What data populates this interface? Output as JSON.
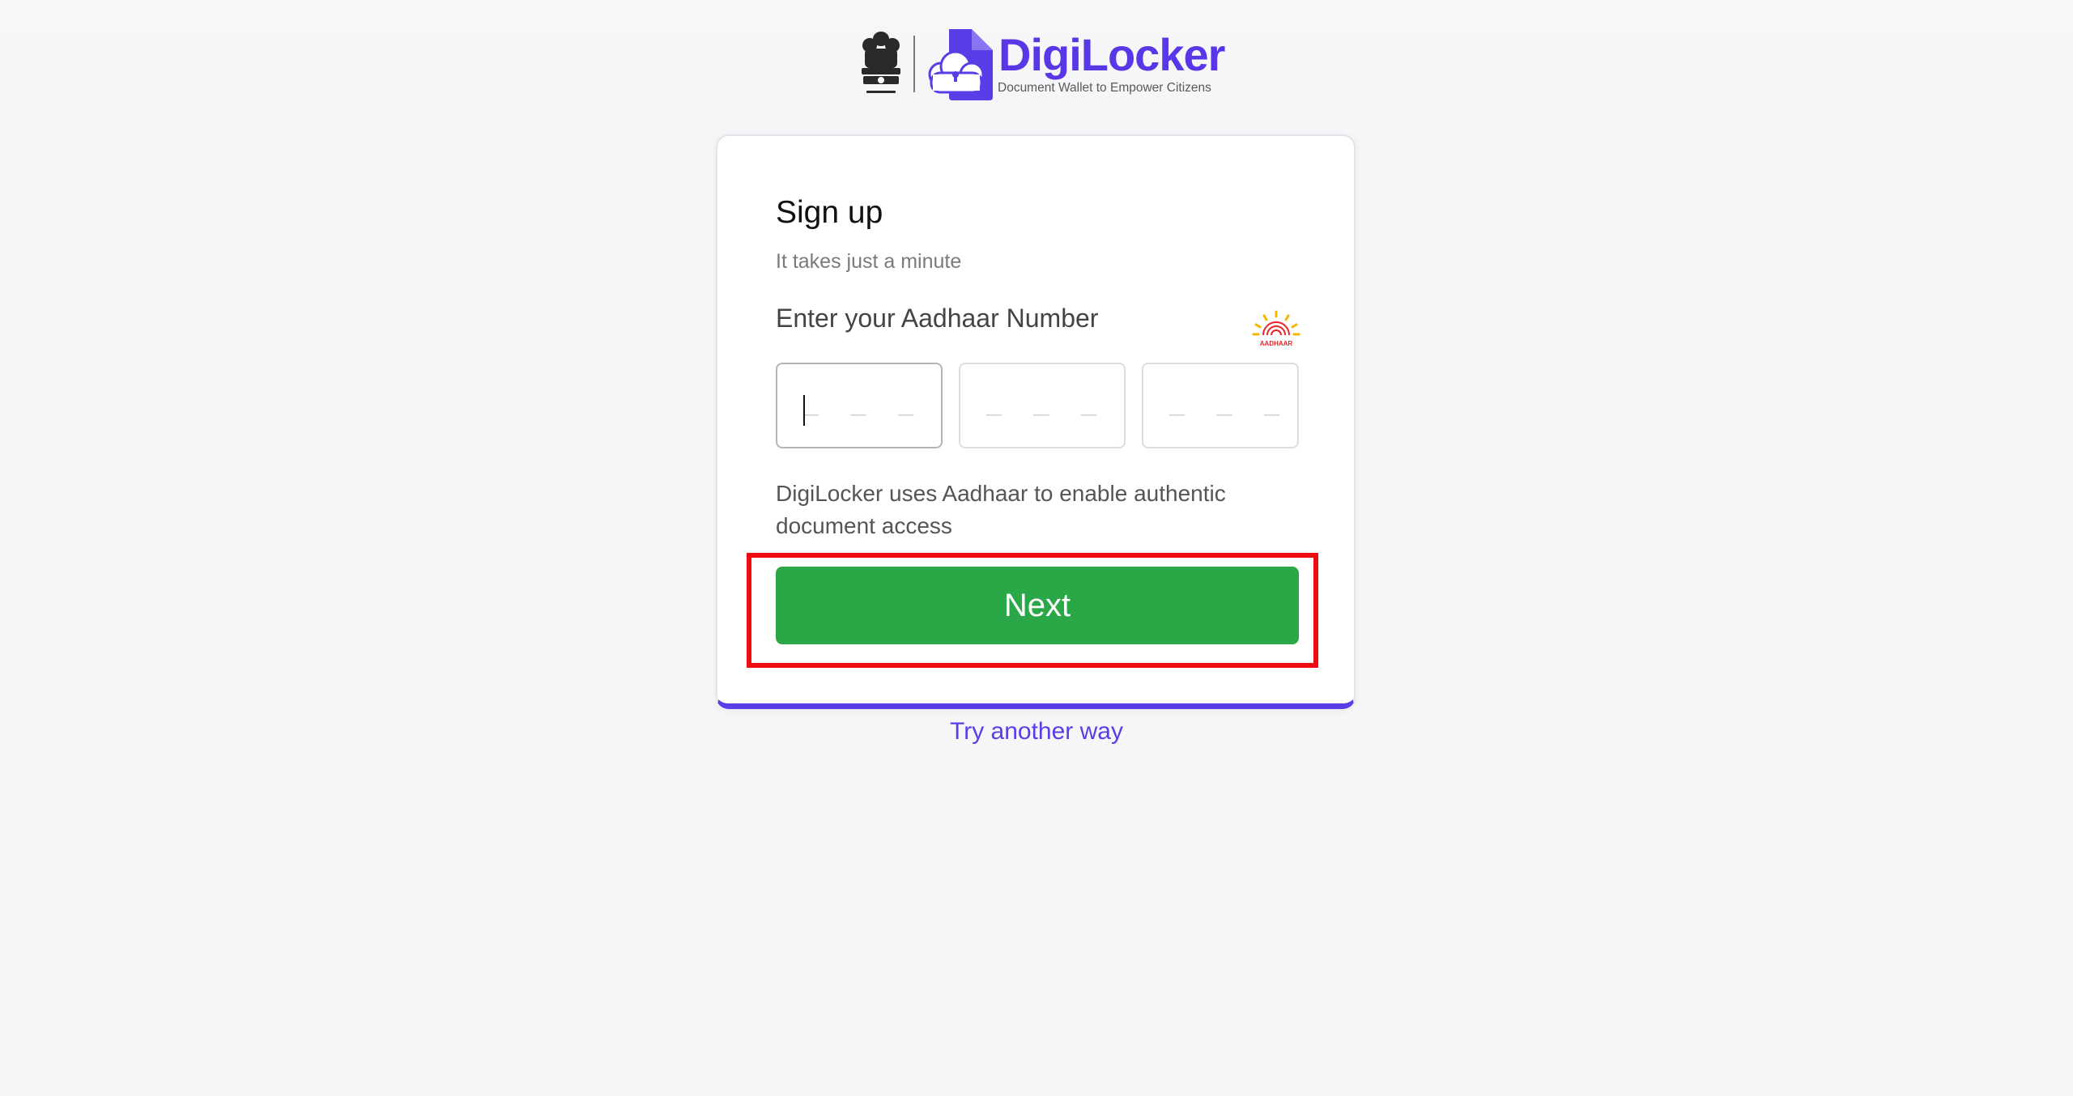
{
  "header": {
    "brand_name": "DigiLocker",
    "tagline": "Document Wallet to Empower Citizens",
    "emblem_icon": "national-emblem-icon",
    "logo_icon": "digilocker-cloud-lock-icon",
    "brand_color": "#5936e6"
  },
  "signup": {
    "title": "Sign up",
    "subtitle": "It takes just a minute",
    "aadhaar_label": "Enter your Aadhaar Number",
    "aadhaar_logo_text": "AADHAAR",
    "inputs": [
      {
        "value": "",
        "placeholder": "_ _ _ _"
      },
      {
        "value": "",
        "placeholder": "_ _ _ _"
      },
      {
        "value": "",
        "placeholder": "_ _ _ _"
      }
    ],
    "info": "DigiLocker uses Aadhaar to enable authentic document access",
    "next_label": "Next",
    "next_color": "#2aa747",
    "accent_color": "#5b3de8"
  },
  "alt_link": "Try another way",
  "highlight_color": "#ee0b12"
}
